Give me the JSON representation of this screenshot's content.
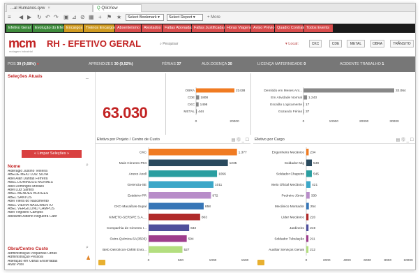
{
  "browser": {
    "tab1": "...al Humanos.qvw",
    "tab2": "QlikView",
    "nav": [
      "◀",
      "▶",
      "↻",
      "☐",
      "⌂"
    ],
    "selector1": "Select Bookmark",
    "selector2": "Select Report",
    "more": "+ More"
  },
  "sheets": [
    {
      "label": "Efetivo Geral",
      "color": "grn"
    },
    {
      "label": "Evolução do Efetivo",
      "color": "grn"
    },
    {
      "label": "Encargos",
      "color": "yel"
    },
    {
      "label": "Treinos Encargos",
      "color": "yel"
    },
    {
      "label": "Absenteísmo",
      "color": "red"
    },
    {
      "label": "Atestados",
      "color": "red"
    },
    {
      "label": "Faltas Abonadas",
      "color": "red"
    },
    {
      "label": "Faltas Justificadas",
      "color": "red"
    },
    {
      "label": "Horas Viagens",
      "color": "red"
    },
    {
      "label": "Aviso Prévio",
      "color": "red"
    },
    {
      "label": "Quadro Contrato",
      "color": "red"
    },
    {
      "label": "Todos Events",
      "color": "red"
    }
  ],
  "header": {
    "logo": "mcm",
    "logo_sub": "motagem industrial",
    "title": "RH - EFETIVO GERAL",
    "search": "Pesquisar",
    "location_label": "Local:",
    "locations": [
      "CKC",
      "CDE",
      "METAL",
      "OBRA",
      "TRÂNSITO"
    ]
  },
  "kpis": [
    {
      "label": "POS",
      "value": "39 (0,68%)"
    },
    {
      "label": "APRENDIZES",
      "value": "30 (0,52%)"
    },
    {
      "label": "FÉRIAS",
      "value": "37"
    },
    {
      "label": "AUX.DOENÇA",
      "value": "30"
    },
    {
      "label": "LICENÇA MATERNIDADE",
      "value": "0"
    },
    {
      "label": "ACIDENTE TRABALHO",
      "value": "1"
    }
  ],
  "left_panel": {
    "selections_title": "Seleções Atuais",
    "clear_button": "Limpar Seleções",
    "name_title": "Nome",
    "names": [
      "Alderagio Justino Teixeira",
      "ABEDE MEIO LUIZ SILVA",
      "Abel Alan Dantas Ferreira",
      "ABEL DOMINGOS MORAES",
      "Abel Domingos Moraes",
      "Abel Luiz Santos",
      "ABEL MENDES BORGES",
      "ABEL SANTOS",
      "Abel Vieira do Nascimento",
      "ABEL VIEIRA NASCIMENTO",
      "ABEL VERGILLINO CAMPOS",
      "Abel Virgolino Campos",
      "Abelardo Aldeno Nogueira Cabr"
    ],
    "obra_title": "Obra/Centro Custo",
    "obras": [
      "Administração Pequenas Obras",
      "Administração Pessoal",
      "Alteração em Obras Encerradas",
      "Alvar Pool"
    ]
  },
  "total": {
    "value": "63.030"
  },
  "mini1": {
    "labels": [
      "OBRA",
      "CDE",
      "CKC",
      "METAL"
    ],
    "values": [
      "22438",
      "1808",
      "1498",
      "444"
    ],
    "ticks": [
      "0",
      "20000"
    ]
  },
  "mini2": {
    "labels": [
      "Demitido em Meses Ant...",
      "Em Atividade Normal",
      "Escalão Logicamente",
      "Gozando Férias"
    ],
    "values": [
      "32.064",
      "1.243",
      "17",
      "37"
    ],
    "ticks": [
      "0",
      "10000",
      "20000",
      "30000"
    ]
  },
  "chart1": {
    "title": "Efetivo por Projeto / Centro de Custo",
    "icons": "▤ Ⓠ _ ☐",
    "labels": [
      "CKC",
      "Mais Cimento P04",
      "Anexo Anoll",
      "Gerencia-SE",
      "Estaleiro-PR",
      "CKC-Macaíbas-Supal",
      "KIMETO-SERSPE S.A....",
      "Companhia de Cimento I...",
      "Oeiro-Química-5A(3503)",
      "Belo Oeiro/Icon-CM08 Enro..."
    ],
    "ticks": [
      "0",
      "500",
      "1000",
      "1500"
    ]
  },
  "chart2": {
    "title": "Efetivo por Cargo",
    "icons": "▤ Ⓠ _ ☐",
    "labels": [
      "Engenheiro Mecânico",
      "Soldador Mig",
      "Soldador Chapeiro",
      "Meio Oficial Mecânico",
      "Pedreiro Júnior",
      "Mecânico Montador",
      "Líder Mecânico",
      "Jardineiro",
      "Soldador Tubulação",
      "Auxiliar Serviços Gerais"
    ],
    "ticks": [
      "0",
      "2000",
      "4000",
      "6000",
      "8000",
      "10000"
    ]
  },
  "chart_data": [
    {
      "type": "bar",
      "title": "Efetivo por Projeto / Centro de Custo",
      "categories": [
        "CKC",
        "Mais Cimento P04",
        "Anexo Anoll",
        "Gerencia-SE",
        "Estaleiro-PR",
        "CKC-Macaíbas-Supal",
        "KIMETO-SERSPE S.A....",
        "Companhia de Cimento I...",
        "Oeiro-Química-5A(3503)",
        "Belo Oeiro/Icon-CM08 Enro..."
      ],
      "values": [
        1377,
        1235,
        1066,
        1011,
        972,
        858,
        803,
        632,
        594,
        527
      ],
      "labels": [
        "1.377",
        "1235",
        "1066",
        "1011",
        "972",
        "858",
        "803",
        "632",
        "594",
        "527"
      ],
      "colors": [
        "#f07b22",
        "#2a4a5e",
        "#2a9ea0",
        "#3ca7c8",
        "#b88dc9",
        "#3776b7",
        "#b02a2a",
        "#4f4f9c",
        "#9e3d8c",
        "#b3de7f"
      ],
      "xlim": [
        0,
        1500
      ],
      "orientation": "horizontal"
    },
    {
      "type": "bar",
      "title": "Efetivo por Cargo",
      "categories": [
        "Engenheiro Mecânico",
        "Soldador Mig",
        "Soldador Chapeiro",
        "Meio Oficial Mecânico",
        "Pedreiro Júnior",
        "Mecânico Montador",
        "Líder Mecânico",
        "Jardineiro",
        "Soldador Tubulação",
        "Auxiliar Serviços Gerais"
      ],
      "values": [
        234,
        549,
        545,
        421,
        330,
        254,
        220,
        219,
        211,
        212
      ],
      "labels": [
        "234",
        "549",
        "545",
        "421",
        "330",
        "254",
        "220",
        "219",
        "211",
        "212"
      ],
      "colors": [
        "#f07b22",
        "#2a4a5e",
        "#2a9ea0",
        "#3ca7c8",
        "#b88dc9",
        "#3776b7",
        "#b02a2a",
        "#4f4f9c",
        "#9e3d8c",
        "#b3de7f"
      ],
      "xlim": [
        0,
        10000
      ],
      "orientation": "horizontal"
    }
  ]
}
